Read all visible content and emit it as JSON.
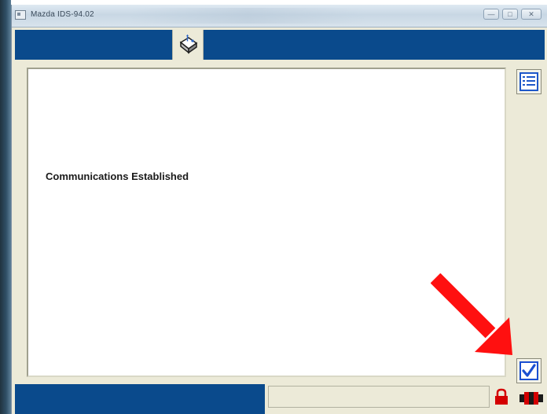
{
  "window": {
    "title": "Mazda IDS-94.02"
  },
  "content": {
    "message": "Communications Established"
  },
  "icons": {
    "app": "app-window-icon",
    "toolbox": "toolbox-tab-icon",
    "list": "list-icon",
    "check": "checkmark-icon",
    "lock": "lock-icon",
    "connector": "connector-icon",
    "annotation": "red-arrow-annotation"
  },
  "colors": {
    "header_blue": "#0a4a8c",
    "panel_beige": "#ecead8",
    "check_blue": "#1a4fd1",
    "status_red": "#d40000",
    "annotation_red": "#ff1010"
  }
}
